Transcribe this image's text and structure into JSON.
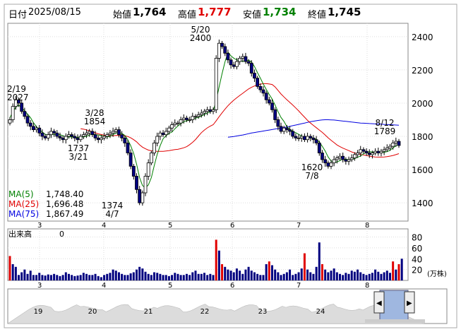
{
  "header": {
    "date_label": "日付",
    "date": "2025/08/15",
    "open_label": "始値",
    "open": "1,764",
    "high_label": "高値",
    "high": "1,777",
    "low_label": "安値",
    "low": "1,734",
    "close_label": "終値",
    "close": "1,745"
  },
  "colors": {
    "up": "#ffffff",
    "down": "#000080",
    "ma5": "#008000",
    "ma25": "#e00000",
    "ma75": "#0000e0",
    "vol_bar": "#000080",
    "vol_hi": "#e00000",
    "high_val": "#e00000",
    "low_val": "#008000"
  },
  "legend": [
    {
      "name": "MA(5)",
      "value": "1,748.40",
      "color": "#008000"
    },
    {
      "name": "MA(25)",
      "value": "1,696.48",
      "color": "#e00000"
    },
    {
      "name": "MA(75)",
      "value": "1,867.49",
      "color": "#0000e0"
    }
  ],
  "volume_panel": {
    "label": "出来高",
    "value": "0",
    "unit": "(万株)"
  },
  "chart_data": {
    "type": "candlestick",
    "x_months": [
      "3",
      "4",
      "5",
      "6",
      "7",
      "8"
    ],
    "y_ticks": [
      1400,
      1600,
      1800,
      2000,
      2200,
      2400
    ],
    "ylim": [
      1290,
      2480
    ],
    "volume_ticks": [
      20,
      40,
      60,
      80
    ],
    "volume_ylim": [
      0,
      95
    ],
    "annotations": [
      {
        "date": "2/19",
        "value": 2027
      },
      {
        "date": "3/28",
        "value": 1854
      },
      {
        "date": "3/21",
        "value": 1737
      },
      {
        "date": "4/7",
        "value": 1374
      },
      {
        "date": "5/20",
        "value": 2400
      },
      {
        "date": "7/8",
        "value": 1620
      },
      {
        "date": "8/12",
        "value": 1789
      }
    ],
    "close": [
      1900,
      1980,
      2020,
      2000,
      1950,
      1920,
      1880,
      1860,
      1840,
      1850,
      1820,
      1800,
      1790,
      1810,
      1830,
      1820,
      1800,
      1790,
      1780,
      1800,
      1810,
      1800,
      1790,
      1780,
      1800,
      1810,
      1820,
      1830,
      1810,
      1790,
      1780,
      1790,
      1800,
      1810,
      1820,
      1830,
      1840,
      1810,
      1790,
      1760,
      1700,
      1620,
      1560,
      1480,
      1400,
      1460,
      1560,
      1640,
      1700,
      1760,
      1800,
      1820,
      1810,
      1830,
      1850,
      1870,
      1880,
      1880,
      1900,
      1910,
      1900,
      1900,
      1920,
      1920,
      1930,
      1940,
      1950,
      1960,
      1950,
      1960,
      2270,
      2360,
      2340,
      2300,
      2260,
      2230,
      2220,
      2250,
      2270,
      2280,
      2250,
      2240,
      2180,
      2150,
      2100,
      2080,
      2060,
      2020,
      2000,
      1960,
      1900,
      1860,
      1830,
      1850,
      1840,
      1830,
      1800,
      1790,
      1790,
      1800,
      1780,
      1800,
      1790,
      1780,
      1760,
      1700,
      1660,
      1640,
      1620,
      1640,
      1660,
      1670,
      1680,
      1660,
      1650,
      1660,
      1670,
      1690,
      1700,
      1720,
      1710,
      1700,
      1690,
      1700,
      1710,
      1700,
      1710,
      1720,
      1730,
      1740,
      1760,
      1770,
      1745
    ],
    "volume": [
      45,
      30,
      25,
      10,
      15,
      20,
      12,
      18,
      10,
      10,
      14,
      10,
      9,
      11,
      10,
      12,
      10,
      8,
      10,
      15,
      12,
      10,
      8,
      9,
      10,
      14,
      12,
      10,
      10,
      12,
      8,
      6,
      10,
      12,
      14,
      20,
      18,
      15,
      12,
      10,
      10,
      13,
      15,
      20,
      25,
      22,
      16,
      12,
      10,
      15,
      14,
      12,
      10,
      10,
      8,
      10,
      14,
      12,
      10,
      10,
      12,
      10,
      15,
      18,
      12,
      12,
      14,
      10,
      12,
      10,
      75,
      55,
      30,
      25,
      20,
      18,
      15,
      22,
      18,
      12,
      20,
      25,
      18,
      15,
      12,
      10,
      10,
      30,
      35,
      28,
      20,
      15,
      10,
      12,
      15,
      20,
      10,
      12,
      15,
      22,
      50,
      20,
      15,
      12,
      25,
      70,
      30,
      20,
      15,
      18,
      22,
      15,
      12,
      10,
      14,
      12,
      18,
      16,
      20,
      15,
      12,
      10,
      12,
      14,
      20,
      16,
      12,
      15,
      18,
      14,
      35,
      20,
      30,
      40
    ],
    "ma5": [
      1912,
      1947,
      1975,
      1988,
      1974,
      1954,
      1934,
      1912,
      1882,
      1858,
      1840,
      1826,
      1812,
      1808,
      1810,
      1812,
      1810,
      1810,
      1804,
      1798,
      1796,
      1796,
      1794,
      1794,
      1796,
      1796,
      1800,
      1808,
      1814,
      1810,
      1808,
      1806,
      1800,
      1796,
      1800,
      1810,
      1820,
      1822,
      1818,
      1806,
      1780,
      1744,
      1698,
      1632,
      1552,
      1504,
      1490,
      1508,
      1552,
      1624,
      1692,
      1744,
      1786,
      1804,
      1818,
      1826,
      1846,
      1862,
      1876,
      1888,
      1894,
      1898,
      1902,
      1910,
      1914,
      1922,
      1932,
      1940,
      1948,
      1952,
      2016,
      2098,
      2176,
      2248,
      2306,
      2284,
      2270,
      2260,
      2256,
      2250,
      2254,
      2258,
      2248,
      2220,
      2184,
      2150,
      2114,
      2082,
      2052,
      2024,
      1988,
      1948,
      1914,
      1890,
      1858,
      1842,
      1830,
      1822,
      1812,
      1802,
      1792,
      1792,
      1792,
      1790,
      1782,
      1766,
      1740,
      1712,
      1676,
      1652,
      1644,
      1646,
      1654,
      1664,
      1662,
      1660,
      1660,
      1666,
      1674,
      1682,
      1694,
      1704,
      1708,
      1706,
      1704,
      1702,
      1702,
      1704,
      1708,
      1716,
      1730,
      1744,
      1748
    ],
    "ma25": [
      null,
      null,
      null,
      null,
      null,
      null,
      null,
      null,
      null,
      null,
      null,
      null,
      null,
      null,
      null,
      null,
      null,
      null,
      null,
      null,
      null,
      null,
      null,
      null,
      1846,
      1843,
      1839,
      1833,
      1828,
      1821,
      1815,
      1811,
      1807,
      1805,
      1804,
      1804,
      1805,
      1806,
      1805,
      1803,
      1799,
      1791,
      1780,
      1767,
      1749,
      1735,
      1725,
      1717,
      1713,
      1711,
      1710,
      1710,
      1710,
      1712,
      1714,
      1717,
      1720,
      1722,
      1726,
      1731,
      1738,
      1750,
      1764,
      1781,
      1802,
      1822,
      1838,
      1851,
      1861,
      1870,
      1893,
      1918,
      1941,
      1963,
      1984,
      2002,
      2018,
      2032,
      2046,
      2059,
      2072,
      2085,
      2095,
      2103,
      2110,
      2114,
      2117,
      2117,
      2115,
      2112,
      2097,
      2076,
      2055,
      2037,
      2020,
      2004,
      1988,
      1971,
      1953,
      1934,
      1915,
      1896,
      1880,
      1866,
      1852,
      1838,
      1824,
      1808,
      1791,
      1776,
      1762,
      1748,
      1738,
      1729,
      1722,
      1714,
      1706,
      1700,
      1695,
      1691,
      1688,
      1685,
      1681,
      1678,
      1676,
      1675,
      1675,
      1676,
      1678,
      1681,
      1685,
      1690,
      1696
    ],
    "ma75": [
      null,
      null,
      null,
      null,
      null,
      null,
      null,
      null,
      null,
      null,
      null,
      null,
      null,
      null,
      null,
      null,
      null,
      null,
      null,
      null,
      null,
      null,
      null,
      null,
      null,
      null,
      null,
      null,
      null,
      null,
      null,
      null,
      null,
      null,
      null,
      null,
      null,
      null,
      null,
      null,
      null,
      null,
      null,
      null,
      null,
      null,
      null,
      null,
      null,
      null,
      null,
      null,
      null,
      null,
      null,
      null,
      null,
      null,
      null,
      null,
      null,
      null,
      null,
      null,
      null,
      null,
      null,
      null,
      null,
      null,
      null,
      null,
      null,
      null,
      1795,
      1797,
      1799,
      1802,
      1805,
      1808,
      1812,
      1816,
      1820,
      1823,
      1826,
      1829,
      1832,
      1835,
      1838,
      1841,
      1844,
      1847,
      1850,
      1853,
      1856,
      1860,
      1864,
      1868,
      1872,
      1876,
      1880,
      1884,
      1888,
      1891,
      1894,
      1897,
      1899,
      1900,
      1900,
      1899,
      1898,
      1896,
      1894,
      1892,
      1890,
      1888,
      1886,
      1884,
      1882,
      1880,
      1879,
      1878,
      1877,
      1876,
      1875,
      1874,
      1873,
      1872,
      1871,
      1870,
      1869,
      1868,
      1867
    ],
    "overview_ticks": [
      "19",
      "20",
      "21",
      "22",
      "23",
      "24"
    ]
  }
}
